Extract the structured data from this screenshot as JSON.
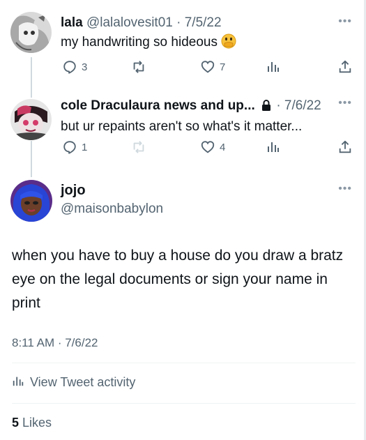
{
  "replies": [
    {
      "name": "lala",
      "handle": "@lalalovesit01",
      "separator": "·",
      "date": "7/5/22",
      "text": "my handwriting so hideous",
      "emoji": "face-with-hand-over-mouth",
      "reply_count": "3",
      "retweet_count": "",
      "like_count": "7"
    },
    {
      "name": "cole Draculaura news and up...",
      "handle": "",
      "separator": "·",
      "date": "7/6/22",
      "text": "but ur repaints aren't so what's it matter...",
      "protected": true,
      "reply_count": "1",
      "retweet_count": "",
      "like_count": "4"
    }
  ],
  "main": {
    "name": "jojo",
    "handle": "@maisonbabylon",
    "text": "when you have to buy a house do you draw a bratz eye on the legal documents or sign your name in print",
    "timestamp": "8:11 AM · 7/6/22",
    "activity_label": "View Tweet activity",
    "likes_count": "5",
    "likes_label": "Likes"
  },
  "icons": {
    "more": "more-horizontal-icon",
    "reply": "reply-icon",
    "retweet": "retweet-icon",
    "like": "heart-icon",
    "views": "analytics-icon",
    "share": "share-icon",
    "lock": "lock-icon"
  },
  "colors": {
    "text": "#0f1419",
    "secondary": "#536471",
    "thread_line": "#cfd9de",
    "retweet_disabled": "#cfd9de"
  }
}
